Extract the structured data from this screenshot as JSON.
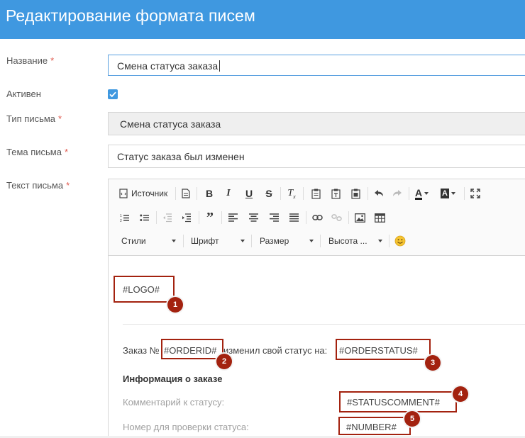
{
  "header": {
    "title": "Редактирование формата писем"
  },
  "form": {
    "name": {
      "label": "Название",
      "required_mark": "*",
      "value": "Смена статуса заказа"
    },
    "active": {
      "label": "Активен",
      "checked": true
    },
    "type": {
      "label": "Тип письма",
      "required_mark": "*",
      "value": "Смена статуса заказа"
    },
    "subject": {
      "label": "Тема письма",
      "required_mark": "*",
      "value": "Статус заказа был изменен"
    },
    "body": {
      "label": "Текст письма",
      "required_mark": "*"
    }
  },
  "editor": {
    "toolbar": {
      "source_label": "Источник",
      "styles_label": "Стили",
      "font_label": "Шрифт",
      "size_label": "Размер",
      "height_label": "Высота ..."
    },
    "content": {
      "logo": "#LOGO#",
      "order_prefix": "Заказ №",
      "order_id": "#ORDERID#",
      "order_middle": "изменил свой статус на:",
      "order_status": "#ORDERSTATUS#",
      "info_heading": "Информация о заказе",
      "comment_label": "Комментарий к статусу:",
      "status_comment": "#STATUSCOMMENT#",
      "number_label": "Номер для проверки статуса:",
      "number": "#NUMBER#"
    }
  },
  "annotations": [
    "1",
    "2",
    "3",
    "4",
    "5"
  ],
  "colors": {
    "header_bg": "#3f98e0",
    "annotation": "#a3220f",
    "required": "#e05a4e"
  }
}
